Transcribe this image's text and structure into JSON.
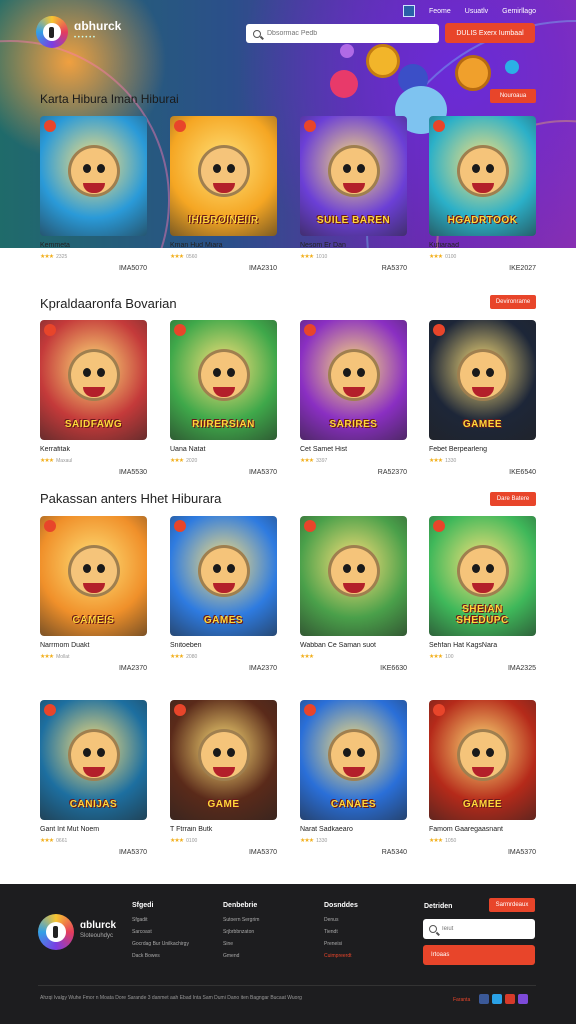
{
  "header": {
    "brand": "ɑbhurck",
    "brand_sub": "• • • • • •",
    "nav": [
      "Feome",
      "Usuatlv",
      "Gemirllago"
    ],
    "search_placeholder": "Dbsormac Pedb",
    "cta_label": "DULIS Exerx Iumbaal"
  },
  "sections": [
    {
      "title": "Karta Hibura Iman Hiburai",
      "action": "Nouroaua",
      "games": [
        {
          "art": "",
          "name": "Kemmeta",
          "rating": "2325",
          "price": "IMA5070"
        },
        {
          "art": "IHIBROINEIIR",
          "name": "Kman Hud Miara",
          "rating": "0560",
          "price": "IMA2310"
        },
        {
          "art": "SUILE BAREN",
          "name": "Nesom Er Dan",
          "rating": "1010",
          "price": "RA5370"
        },
        {
          "art": "HGADRTOOK",
          "name": "Kutiaraad",
          "rating": "0100",
          "price": "IKE2027"
        }
      ]
    },
    {
      "title": "Kpraldaaronfa Bovarian",
      "action": "Devironrame",
      "games": [
        {
          "art": "SAIDFAWG",
          "name": "Kerrafitak",
          "rating": "Maxaul",
          "price": "IMA5530"
        },
        {
          "art": "RIIRERSIAN",
          "name": "Uana Natat",
          "rating": "2020",
          "price": "IMA5370"
        },
        {
          "art": "SARIRES",
          "name": "Cet Samet Hist",
          "rating": "3397",
          "price": "RA52370"
        },
        {
          "art": "GAMEE",
          "name": "Febet Berpearleng",
          "rating": "1330",
          "price": "IKE6540"
        }
      ]
    },
    {
      "title": "Pakassan anters Hhet Hiburara",
      "action": "Dare Batere",
      "games": [
        {
          "art": "CAMEIS",
          "name": "Narrmom Duakt",
          "rating": "Mollat",
          "price": "IMA2370"
        },
        {
          "art": "GAMES",
          "name": "Snitoeben",
          "rating": "2080",
          "price": "IMA2370"
        },
        {
          "art": "",
          "name": "Wabban Ce Saman suot",
          "rating": "",
          "price": "IKE6630"
        },
        {
          "art": "SHEIAN SHEDUPC",
          "name": "Sehfan Hat KagsNara",
          "rating": "100",
          "price": "IMA2325"
        }
      ]
    },
    {
      "title": "",
      "action": "",
      "games": [
        {
          "art": "CANIJAS",
          "name": "Gant Int Mut Noem",
          "rating": "0661",
          "price": "IMA5370"
        },
        {
          "art": "GAME",
          "name": "T Ftrrain Butk",
          "rating": "0100",
          "price": "IMA5370"
        },
        {
          "art": "CANAES",
          "name": "Narat Sadkaearo",
          "rating": "1330",
          "price": "RA5340"
        },
        {
          "art": "GAMEE",
          "name": "Famom Gaaregaasnant",
          "rating": "1050",
          "price": "IMA5370"
        }
      ]
    }
  ],
  "footer": {
    "brand": "ɑblurck",
    "brand_sub": "Sloteouhdyc",
    "columns": [
      {
        "title": "Sfgedi",
        "links": [
          "Sfgadit",
          "Sarcoast",
          "Gocrdag Bur Unilkachirgy",
          "Dack Bowes"
        ]
      },
      {
        "title": "Denbebrie",
        "links": [
          "Sutoern Sergrim",
          "Srjbrbbnzaton",
          "Sine",
          "Gmend"
        ]
      },
      {
        "title": "Dosnddes",
        "links": [
          "Denus",
          "Tiendt",
          "Preneisi",
          "Cuimpreerdt"
        ]
      }
    ],
    "newsletter_title": "Detriden",
    "newsletter_top_btn": "Sarmrdeaux",
    "newsletter_placeholder": "Ieiut",
    "newsletter_submit": "Irtoaas",
    "copyright": "Ahzqi Ivalgy Wuhe Fmor n Moata Dore Sarande 3 danmet aah Ebad Inta Sam Dumi Dano iten Bagngar Bucaat Wuorg",
    "social_label": "Faranta"
  },
  "colors": {
    "accent": "#e8452a",
    "footer_bg": "#1d1d1f",
    "star": "#f2b01e"
  }
}
